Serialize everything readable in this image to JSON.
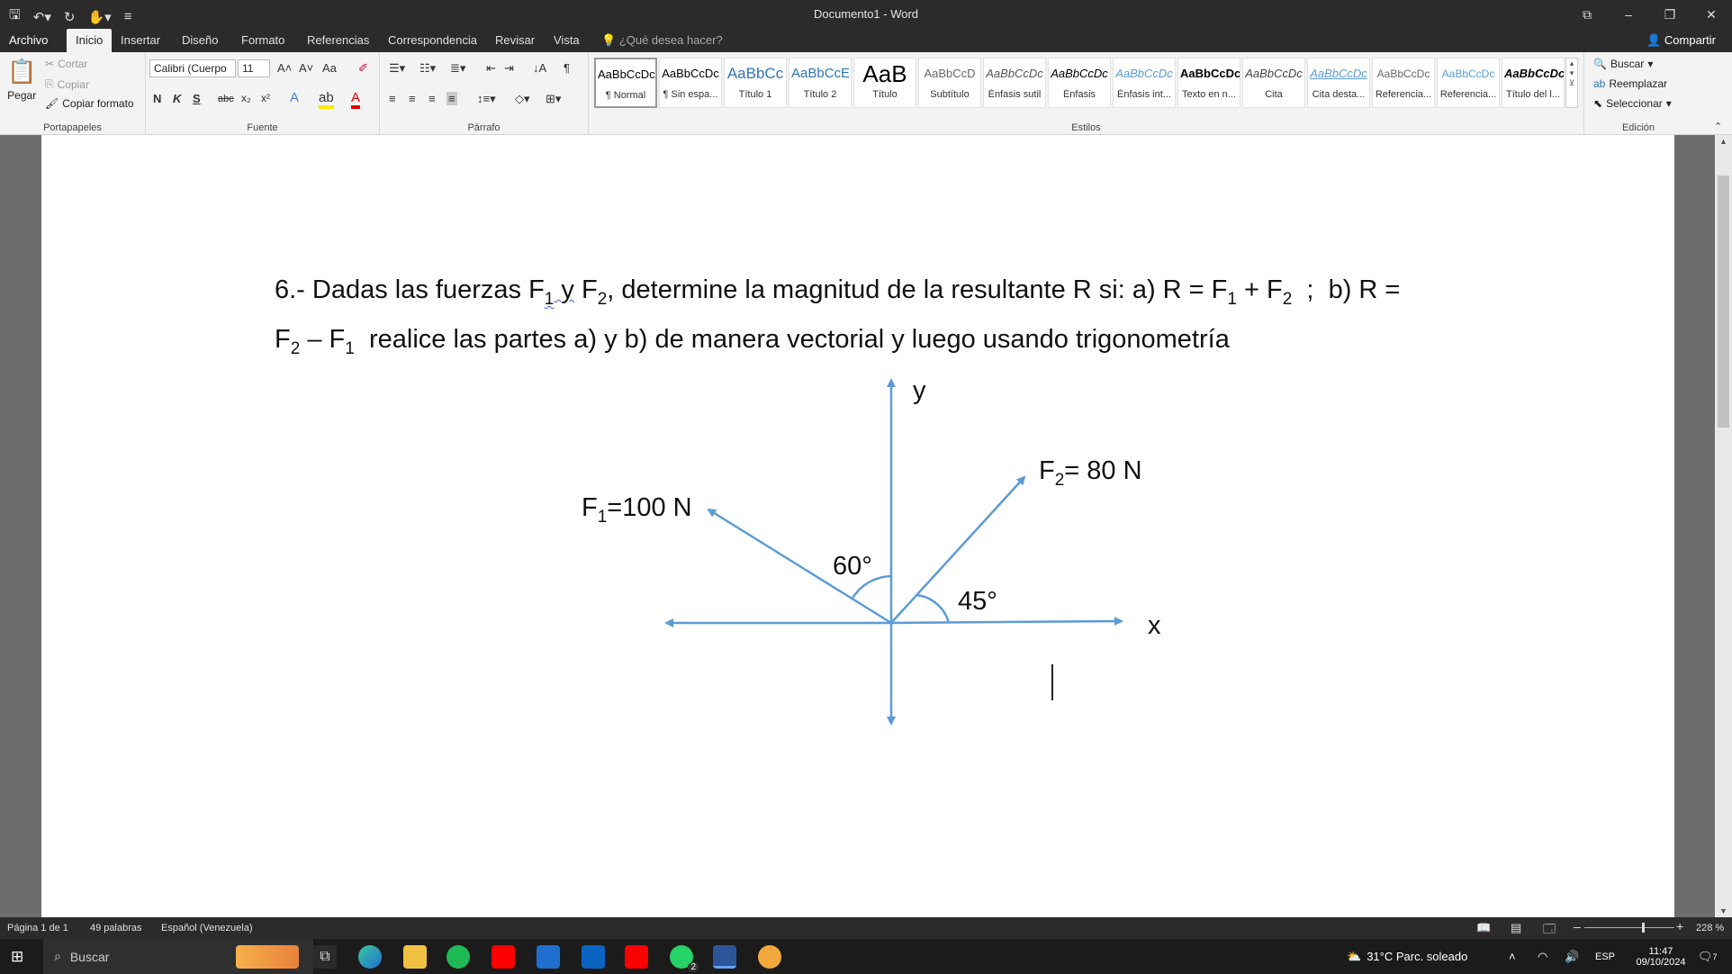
{
  "window": {
    "title": "Documento1 - Word",
    "controls": {
      "restore": "⧉",
      "minimize": "–",
      "maximize": "❐",
      "close": "✕"
    }
  },
  "qat": {
    "save_icon": "save-icon",
    "undo_icon": "undo-icon",
    "redo_icon": "redo-icon",
    "touch_icon": "touch-mode-icon",
    "customize_icon": "customize-qat-icon"
  },
  "tabs": [
    {
      "label": "Archivo"
    },
    {
      "label": "Inicio"
    },
    {
      "label": "Insertar"
    },
    {
      "label": "Diseño"
    },
    {
      "label": "Formato"
    },
    {
      "label": "Referencias"
    },
    {
      "label": "Correspondencia"
    },
    {
      "label": "Revisar"
    },
    {
      "label": "Vista"
    }
  ],
  "tellme": "¿Qué desea hacer?",
  "share": "Compartir",
  "ribbon": {
    "clipboard": {
      "label": "Portapapeles",
      "paste": "Pegar",
      "cut": "Cortar",
      "copy": "Copiar",
      "format_painter": "Copiar formato"
    },
    "font": {
      "label": "Fuente",
      "font_name": "Calibri (Cuerpo",
      "font_size": "11",
      "bold": "N",
      "italic": "K",
      "underline": "S",
      "strike": "abc",
      "sub": "x₂",
      "sup": "x²",
      "case": "Aa"
    },
    "paragraph": {
      "label": "Párrafo"
    },
    "styles": {
      "label": "Estilos",
      "items": [
        {
          "preview": "AaBbCcDc",
          "name": "¶ Normal"
        },
        {
          "preview": "AaBbCcDc",
          "name": "¶ Sin espa..."
        },
        {
          "preview": "AaBbCc",
          "name": "Título 1"
        },
        {
          "preview": "AaBbCcE",
          "name": "Título 2"
        },
        {
          "preview": "AaB",
          "name": "Título"
        },
        {
          "preview": "AaBbCcD",
          "name": "Subtítulo"
        },
        {
          "preview": "AaBbCcDc",
          "name": "Énfasis sutil"
        },
        {
          "preview": "AaBbCcDc",
          "name": "Énfasis"
        },
        {
          "preview": "AaBbCcDc",
          "name": "Énfasis int..."
        },
        {
          "preview": "AaBbCcDc",
          "name": "Texto en n..."
        },
        {
          "preview": "AaBbCcDc",
          "name": "Cita"
        },
        {
          "preview": "AaBbCcDc",
          "name": "Cita desta..."
        },
        {
          "preview": "AaBbCcDc",
          "name": "Referencia..."
        },
        {
          "preview": "AaBbCcDc",
          "name": "Referencia..."
        },
        {
          "preview": "AaBbCcDc",
          "name": "Título del l..."
        }
      ]
    },
    "editing": {
      "label": "Edición",
      "find": "Buscar",
      "replace": "Reemplazar",
      "select": "Seleccionar"
    }
  },
  "document": {
    "problem_line1_a": "6.- Dadas las fuerzas F",
    "problem_line1_b": "1",
    "problem_line1_c": " y",
    "problem_line1_d": " F",
    "problem_line1_e": "2",
    "problem_line1_f": ", determine la magnitud de la resultante R si:  a) R = F",
    "problem_line1_g": "1",
    "problem_line1_h": " + F",
    "problem_line1_i": "2",
    "problem_line1_j": "  ;  b) R =",
    "problem_line2_a": "F",
    "problem_line2_b": "2",
    "problem_line2_c": " – F",
    "problem_line2_d": "1",
    "problem_line2_e": "  realice las partes a) y b) de manera vectorial y luego usando trigonometría",
    "diagram": {
      "y_label": "y",
      "x_label": "x",
      "f1_main": "F",
      "f1_sub": "1",
      "f1_rest": "=100 N",
      "f2_main": "F",
      "f2_sub": "2",
      "f2_rest": "= 80 N",
      "angle1": "60°",
      "angle2": "45°",
      "arrow_color": "#5b9bd5"
    }
  },
  "status": {
    "page": "Página 1 de 1",
    "words": "49 palabras",
    "language": "Español (Venezuela)",
    "zoom": "228 %"
  },
  "taskbar": {
    "search": "Buscar",
    "weather": "31°C  Parc. soleado",
    "lang": "ESP",
    "time": "11:47",
    "date": "09/10/2024",
    "notif_count": "7",
    "whatsapp_badge": "2"
  }
}
